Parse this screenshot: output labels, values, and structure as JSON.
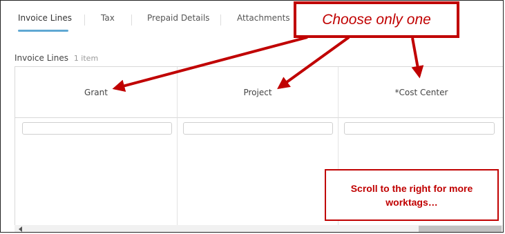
{
  "tabs": [
    {
      "label": "Invoice Lines",
      "active": true
    },
    {
      "label": "Tax",
      "active": false
    },
    {
      "label": "Prepaid Details",
      "active": false
    },
    {
      "label": "Attachments",
      "active": false
    }
  ],
  "section": {
    "title": "Invoice Lines",
    "count": "1 item"
  },
  "columns": [
    {
      "header": "Grant",
      "value": ""
    },
    {
      "header": "Project",
      "value": ""
    },
    {
      "header": "*Cost Center",
      "value": ""
    }
  ],
  "annotations": {
    "top": "Choose only one",
    "bottom": "Scroll to the right for more worktags…",
    "color": "#c00000"
  }
}
